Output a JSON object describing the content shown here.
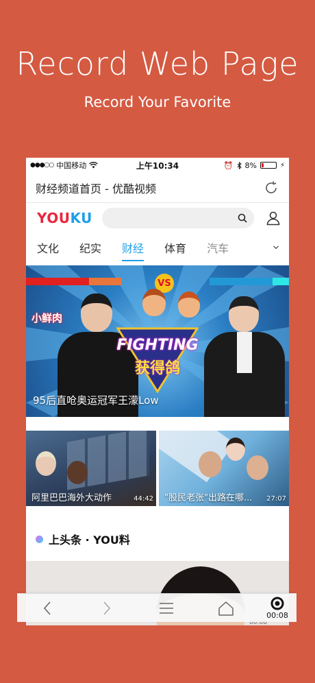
{
  "promo": {
    "title": "Record Web Page",
    "subtitle": "Record Your Favorite"
  },
  "status_bar": {
    "carrier": "中国移动",
    "time": "上午10:34",
    "battery": "8%"
  },
  "address_bar": {
    "page_title": "财经频道首页 - 优酷视频"
  },
  "youku": {
    "logo_you": "YOU",
    "logo_ku": "KU",
    "search_placeholder": ""
  },
  "tabs": [
    {
      "label": "文化"
    },
    {
      "label": "纪实"
    },
    {
      "label": "财经",
      "active": true
    },
    {
      "label": "体育"
    },
    {
      "label": "汽车"
    }
  ],
  "hero": {
    "caption": "95后直呛奥运冠军王濛Low",
    "logo_text": "小鲜肉",
    "title_text": "FIGHTING",
    "title_cn": "获得鸽"
  },
  "videos": [
    {
      "title": "阿里巴巴海外大动作",
      "duration": "44:42"
    },
    {
      "title": "\"股民老张\"出路在哪...",
      "duration": "27:07"
    }
  ],
  "section": {
    "title": "上头条 · YOU料"
  },
  "toolbar": {
    "record_time": "00:08",
    "ghost_time": "00:08"
  },
  "colors": {
    "background": "#d45a42",
    "youku_red": "#e8273f",
    "youku_blue": "#1f9fe8",
    "active_tab": "#1f9fe8"
  }
}
